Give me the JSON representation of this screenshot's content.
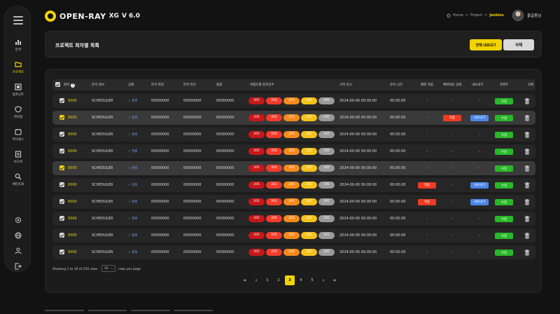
{
  "app": {
    "logo_text": "OPEN-RAY",
    "logo_sub": "XG",
    "version": "V 6.0"
  },
  "sidebar": {
    "items": [
      {
        "label": "분석",
        "icon": "bar-chart-icon"
      },
      {
        "label": "프로젝트",
        "icon": "folder-icon",
        "active": true
      },
      {
        "label": "컴포넌트",
        "icon": "component-icon"
      },
      {
        "label": "취약점",
        "icon": "shield-icon"
      },
      {
        "label": "라이센스",
        "icon": "license-icon"
      },
      {
        "label": "보고서",
        "icon": "report-icon"
      },
      {
        "label": "패턴조회",
        "icon": "search-icon"
      }
    ],
    "bottom_icons": [
      "settings-icon",
      "globe-icon",
      "user-icon",
      "logout-icon"
    ]
  },
  "breadcrumb": {
    "home": "Home",
    "sep1": ">",
    "project": "Project",
    "sep2": ">",
    "current": "Jenkins"
  },
  "user": {
    "name": "홍길동님"
  },
  "page": {
    "title": "프로젝트 회차별 목록",
    "export_all_label": "전체 내보내기",
    "delete_label": "삭제"
  },
  "table": {
    "headers": [
      "회차",
      "분석 정보",
      "상태",
      "분석 파일",
      "분석 라인",
      "총합",
      "위험도별 탐지건수",
      "시작 일시",
      "분석 시간",
      "예외 적용",
      "예외적용 상태",
      "내보내기",
      "코멘트",
      "삭제"
    ],
    "rows": [
      {
        "selected": false,
        "round": "0000",
        "info": "SCHEDULER",
        "status": "✓ 완료",
        "files": "00000000",
        "lines": "00000000",
        "total": "00000000",
        "risk": [
          "205",
          "205",
          "205",
          "205",
          "205"
        ],
        "start": "2024-00-00 00:00:00",
        "time": "00:00:00",
        "exception": "-",
        "exception_status": "-",
        "export": "-",
        "edit": "수정"
      },
      {
        "selected": true,
        "round": "0000",
        "info": "SCHEDULER",
        "status": "✓ 완료",
        "files": "00000000",
        "lines": "00000000",
        "total": "00000000",
        "risk": [
          "205",
          "205",
          "205",
          "205",
          "205"
        ],
        "start": "2024-00-00 00:00:00",
        "time": "00:00:00",
        "exception": "-",
        "exception_status": "적용",
        "export": "내보내기",
        "edit": "수정"
      },
      {
        "selected": false,
        "round": "0000",
        "info": "SCHEDULER",
        "status": "✓ 완료",
        "files": "00000000",
        "lines": "00000000",
        "total": "00000000",
        "risk": [
          "205",
          "205",
          "205",
          "205",
          "205"
        ],
        "start": "2024-00-00 00:00:00",
        "time": "00:00:00",
        "exception": "-",
        "exception_status": "-",
        "export": "-",
        "edit": "수정"
      },
      {
        "selected": false,
        "round": "0000",
        "info": "SCHEDULER",
        "status": "✓ 완료",
        "files": "00000000",
        "lines": "00000000",
        "total": "00000000",
        "risk": [
          "205",
          "205",
          "205",
          "205",
          "205"
        ],
        "start": "2024-00-00 00:00:00",
        "time": "00:00:00",
        "exception": "-",
        "exception_status": "-",
        "export": "-",
        "edit": "수정"
      },
      {
        "selected": true,
        "round": "0000",
        "info": "SCHEDULER",
        "status": "✓ 완료",
        "files": "00000000",
        "lines": "00000000",
        "total": "00000000",
        "risk": [
          "205",
          "205",
          "205",
          "205",
          "205"
        ],
        "start": "2024-00-00 00:00:00",
        "time": "00:00:00",
        "exception": "-",
        "exception_status": "-",
        "export": "-",
        "edit": "수정"
      },
      {
        "selected": false,
        "round": "0000",
        "info": "SCHEDULER",
        "status": "✓ 완료",
        "files": "00000000",
        "lines": "00000000",
        "total": "00000000",
        "risk": [
          "205",
          "205",
          "205",
          "205",
          "205"
        ],
        "start": "2024-00-00 00:00:00",
        "time": "00:00:00",
        "exception": "적용",
        "exception_status": "-",
        "export": "내보내기",
        "edit": "수정"
      },
      {
        "selected": false,
        "round": "0000",
        "info": "SCHEDULER",
        "status": "✓ 완료",
        "files": "00000000",
        "lines": "00000000",
        "total": "00000000",
        "risk": [
          "205",
          "205",
          "205",
          "205",
          "205"
        ],
        "start": "2024-00-00 00:00:00",
        "time": "00:00:00",
        "exception": "적용",
        "exception_status": "-",
        "export": "내보내기",
        "edit": "수정"
      },
      {
        "selected": false,
        "round": "0000",
        "info": "SCHEDULER",
        "status": "✓ 완료",
        "files": "00000000",
        "lines": "00000000",
        "total": "00000000",
        "risk": [
          "205",
          "205",
          "205",
          "205",
          "205"
        ],
        "start": "2024-00-00 00:00:00",
        "time": "00:00:00",
        "exception": "-",
        "exception_status": "-",
        "export": "-",
        "edit": "수정"
      },
      {
        "selected": false,
        "round": "0000",
        "info": "SCHEDULER",
        "status": "✓ 완료",
        "files": "00000000",
        "lines": "00000000",
        "total": "00000000",
        "risk": [
          "205",
          "205",
          "205",
          "205",
          "205"
        ],
        "start": "2024-00-00 00:00:00",
        "time": "00:00:00",
        "exception": "-",
        "exception_status": "-",
        "export": "-",
        "edit": "수정"
      },
      {
        "selected": false,
        "round": "0000",
        "info": "SCHEDULER",
        "status": "✓ 완료",
        "files": "00000000",
        "lines": "00000000",
        "total": "00000000",
        "risk": [
          "205",
          "205",
          "205",
          "205",
          "205"
        ],
        "start": "2024-00-00 00:00:00",
        "time": "00:00:00",
        "exception": "-",
        "exception_status": "-",
        "export": "-",
        "edit": "수정"
      }
    ]
  },
  "footer": {
    "showing": "Showing 1 to 10 of 216 rows",
    "rows_per_page_value": "10",
    "rows_per_page_label": "rows per page",
    "pages": [
      "1",
      "2",
      "3",
      "4",
      "5"
    ],
    "current_page": "3",
    "first": "«",
    "prev": "‹",
    "next": "›",
    "last": "»"
  },
  "colors": {
    "accent": "#f2d400",
    "edit_green": "#28b828",
    "badge_red": "#ee3b22",
    "badge_blue": "#4a86e8"
  }
}
